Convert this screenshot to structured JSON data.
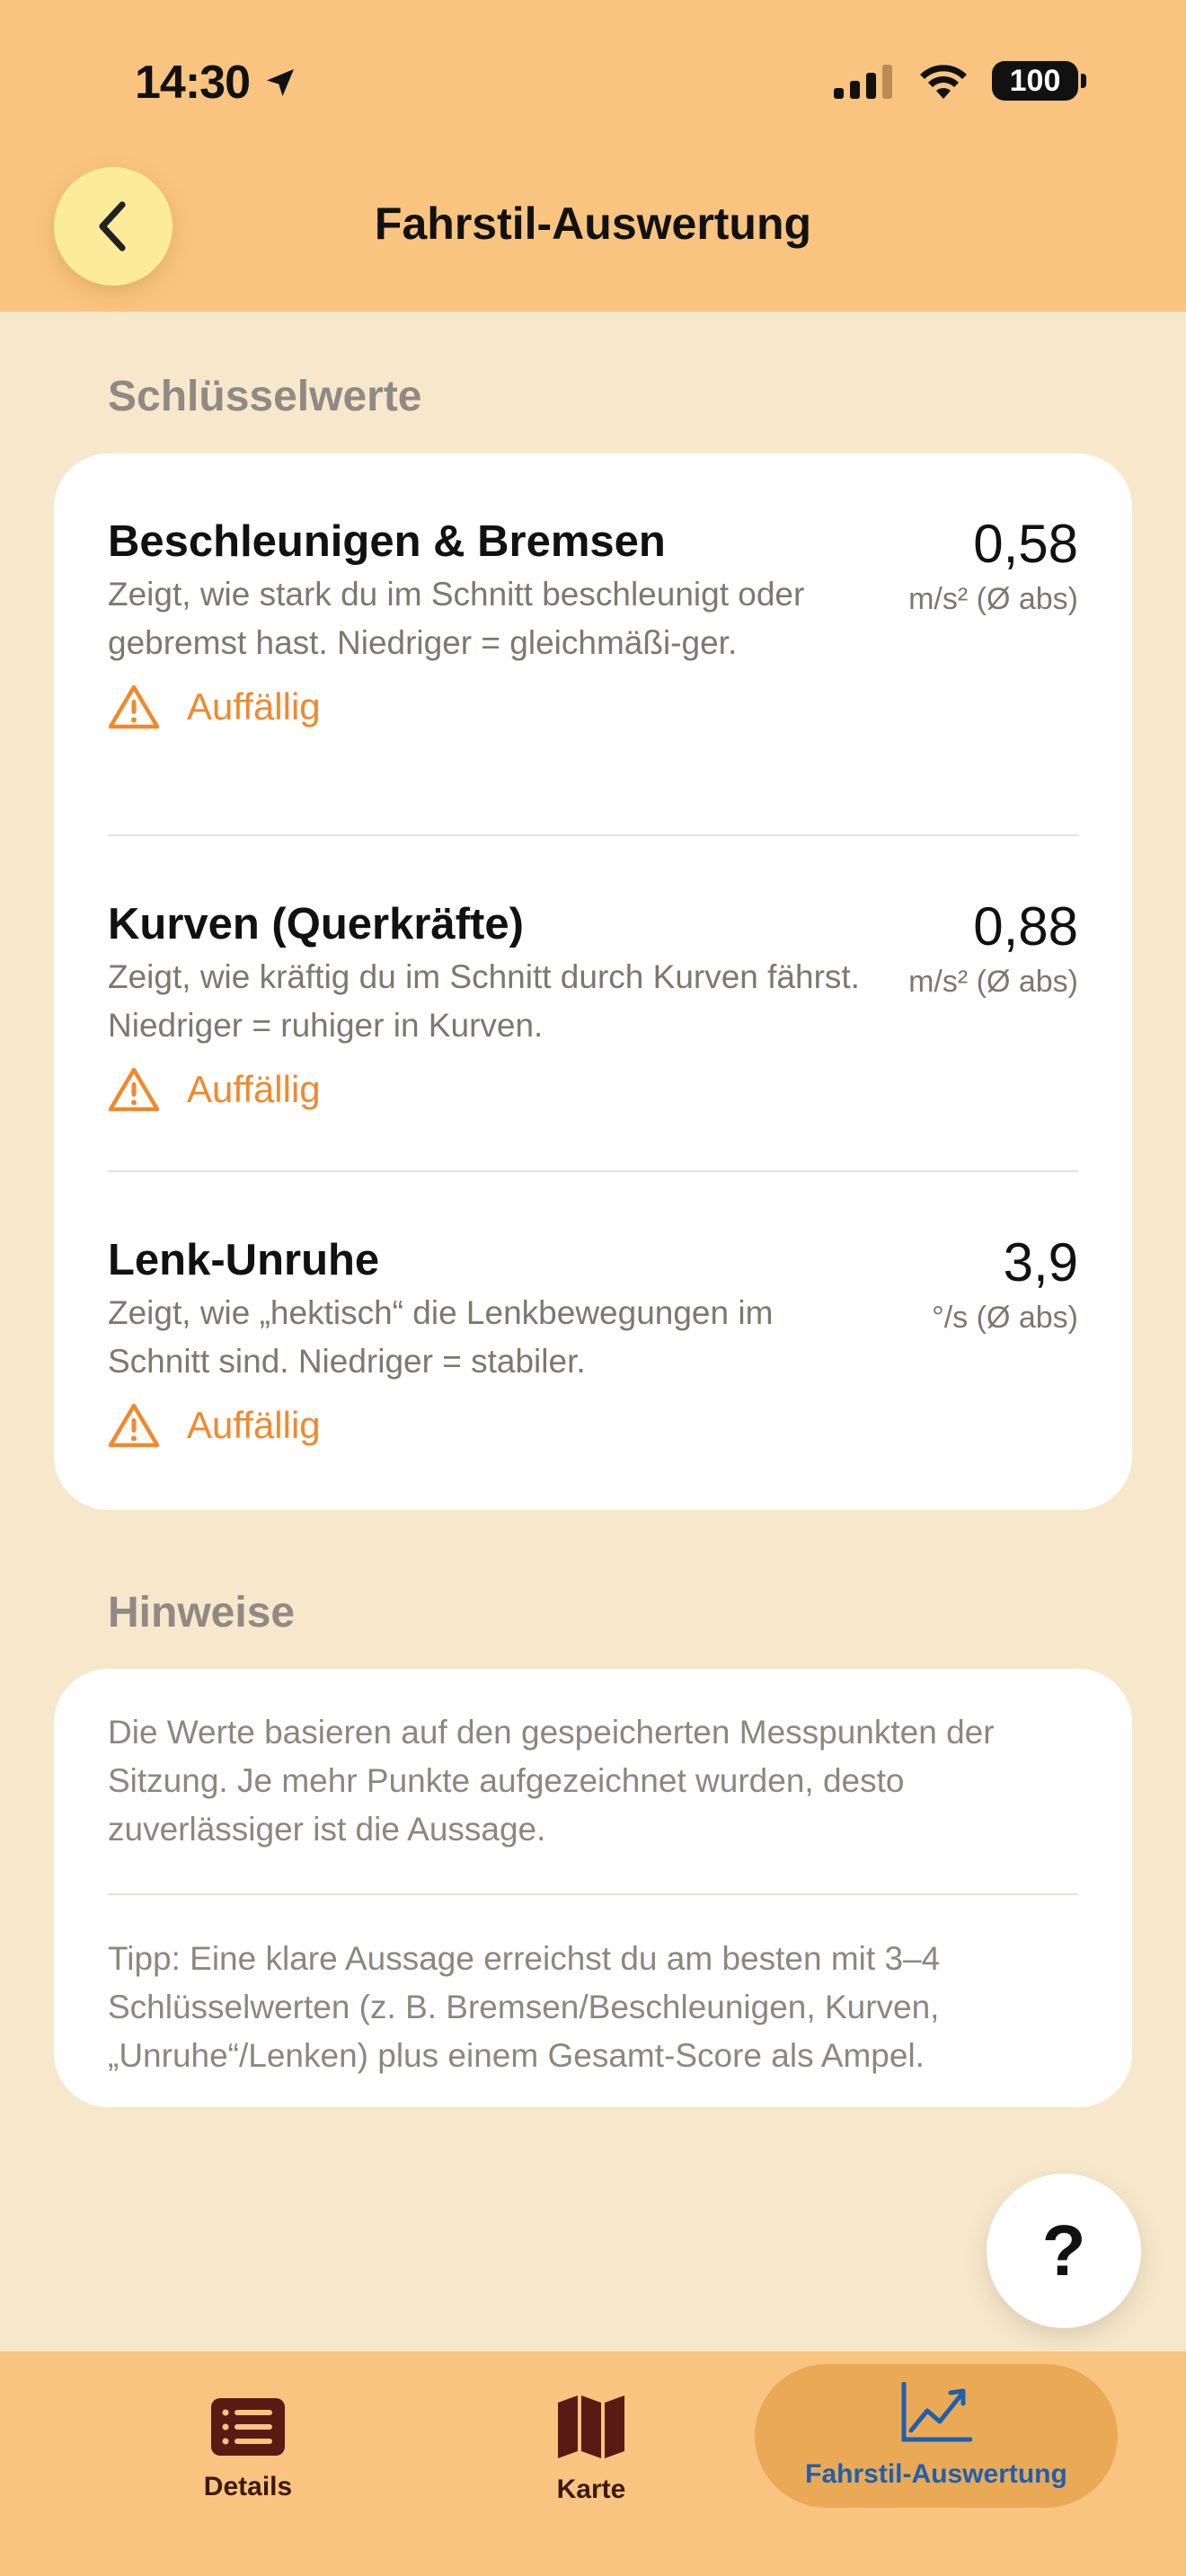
{
  "status_bar": {
    "time": "14:30",
    "battery": "100"
  },
  "header": {
    "title": "Fahrstil-Auswertung"
  },
  "key_values": {
    "heading": "Schlüsselwerte",
    "items": [
      {
        "title": "Beschleunigen & Bremsen",
        "description": "Zeigt, wie stark du im Schnitt beschleunigt oder gebremst hast. Niedriger = gleichmäßi-ger.",
        "value": "0,58",
        "unit": "m/s² (Ø abs)",
        "status": "Auffällig"
      },
      {
        "title": "Kurven (Querkräfte)",
        "description": "Zeigt, wie kräftig du im Schnitt durch Kurven fährst. Niedriger = ruhiger in Kurven.",
        "value": "0,88",
        "unit": "m/s² (Ø abs)",
        "status": "Auffällig"
      },
      {
        "title": "Lenk-Unruhe",
        "description": "Zeigt, wie „hektisch“ die Lenkbewegungen im Schnitt sind. Niedriger = stabiler.",
        "value": "3,9",
        "unit": "°/s (Ø abs)",
        "status": "Auffällig"
      }
    ]
  },
  "notes": {
    "heading": "Hinweise",
    "items": [
      "Die Werte basieren auf den gespeicherten Messpunkten der Sitzung. Je mehr Punkte aufgezeichnet wurden, desto zuverlässiger ist die Aussage.",
      "Tipp: Eine klare Aussage erreichst du am besten mit 3–4 Schlüsselwerten (z. B. Bremsen/Beschleunigen, Kurven, „Unruhe“/Lenken) plus einem Gesamt-Score als Ampel."
    ]
  },
  "help_button": {
    "label": "?"
  },
  "tabbar": {
    "tabs": [
      {
        "label": "Details",
        "icon": "list-icon"
      },
      {
        "label": "Karte",
        "icon": "map-icon"
      },
      {
        "label": "Fahrstil-Auswertung",
        "icon": "chart-icon",
        "active": true
      }
    ]
  },
  "colors": {
    "header_bg": "#f9c47f",
    "page_bg": "#f8e8cb",
    "warning": "#f0892e",
    "active_tab": "#1f5fae"
  }
}
